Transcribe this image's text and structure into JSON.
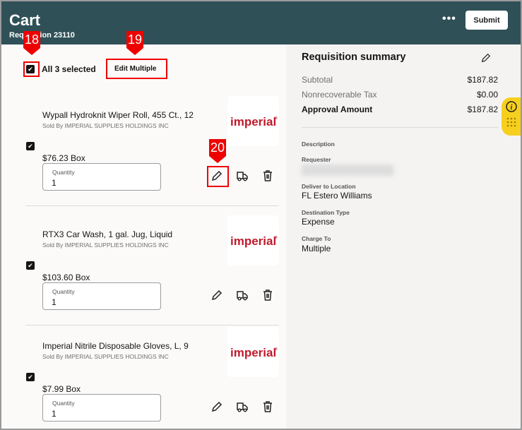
{
  "header": {
    "title": "Cart",
    "subtitle": "Requisition 23110",
    "more": "•••",
    "submit": "Submit"
  },
  "toolbar": {
    "select_all": "All 3 selected",
    "edit_multiple": "Edit Multiple"
  },
  "items": [
    {
      "name": "Wypall Hydroknit Wiper Roll, 455 Ct., 12",
      "seller": "Sold By IMPERIAL SUPPLIES HOLDINGS INC",
      "price": "$76.23 Box",
      "quantity_label": "Quantity",
      "quantity": "1",
      "logo": "imperial",
      "checked": true
    },
    {
      "name": "RTX3 Car Wash, 1 gal. Jug, Liquid",
      "seller": "Sold By IMPERIAL SUPPLIES HOLDINGS INC",
      "price": "$103.60 Box",
      "quantity_label": "Quantity",
      "quantity": "1",
      "logo": "imperial",
      "checked": true
    },
    {
      "name": "Imperial Nitrile Disposable Gloves, L, 9",
      "seller": "Sold By IMPERIAL SUPPLIES HOLDINGS INC",
      "price": "$7.99 Box",
      "quantity_label": "Quantity",
      "quantity": "1",
      "logo": "imperial",
      "checked": true
    }
  ],
  "summary": {
    "title": "Requisition summary",
    "subtotal_label": "Subtotal",
    "subtotal": "$187.82",
    "tax_label": "Nonrecoverable Tax",
    "tax": "$0.00",
    "approval_label": "Approval Amount",
    "approval": "$187.82",
    "description_label": "Description",
    "requester_label": "Requester",
    "deliver_label": "Deliver to Location",
    "deliver": "FL Estero Williams",
    "dest_label": "Destination Type",
    "dest": "Expense",
    "charge_label": "Charge To",
    "charge": "Multiple"
  },
  "annotations": [
    "18",
    "19",
    "20"
  ]
}
